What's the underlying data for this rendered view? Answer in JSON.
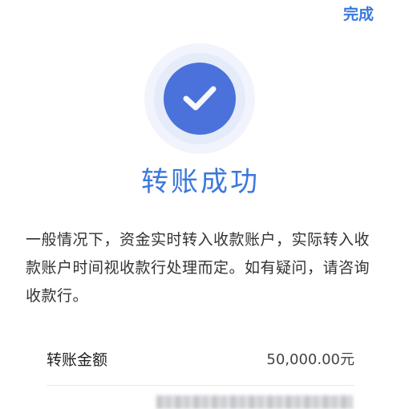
{
  "header": {
    "done_label": "完成"
  },
  "status": {
    "icon": "check-icon",
    "title": "转账成功",
    "description": "一般情况下，资金实时转入收款账户，实际转入收款账户时间视收款行处理而定。如有疑问，请咨询收款行。"
  },
  "details": [
    {
      "label": "转账金额",
      "value": "50,000.00元"
    }
  ],
  "colors": {
    "accent": "#3a78de",
    "icon_fill": "#4b72da",
    "halo": "#e6ebf9",
    "text": "#333333"
  }
}
